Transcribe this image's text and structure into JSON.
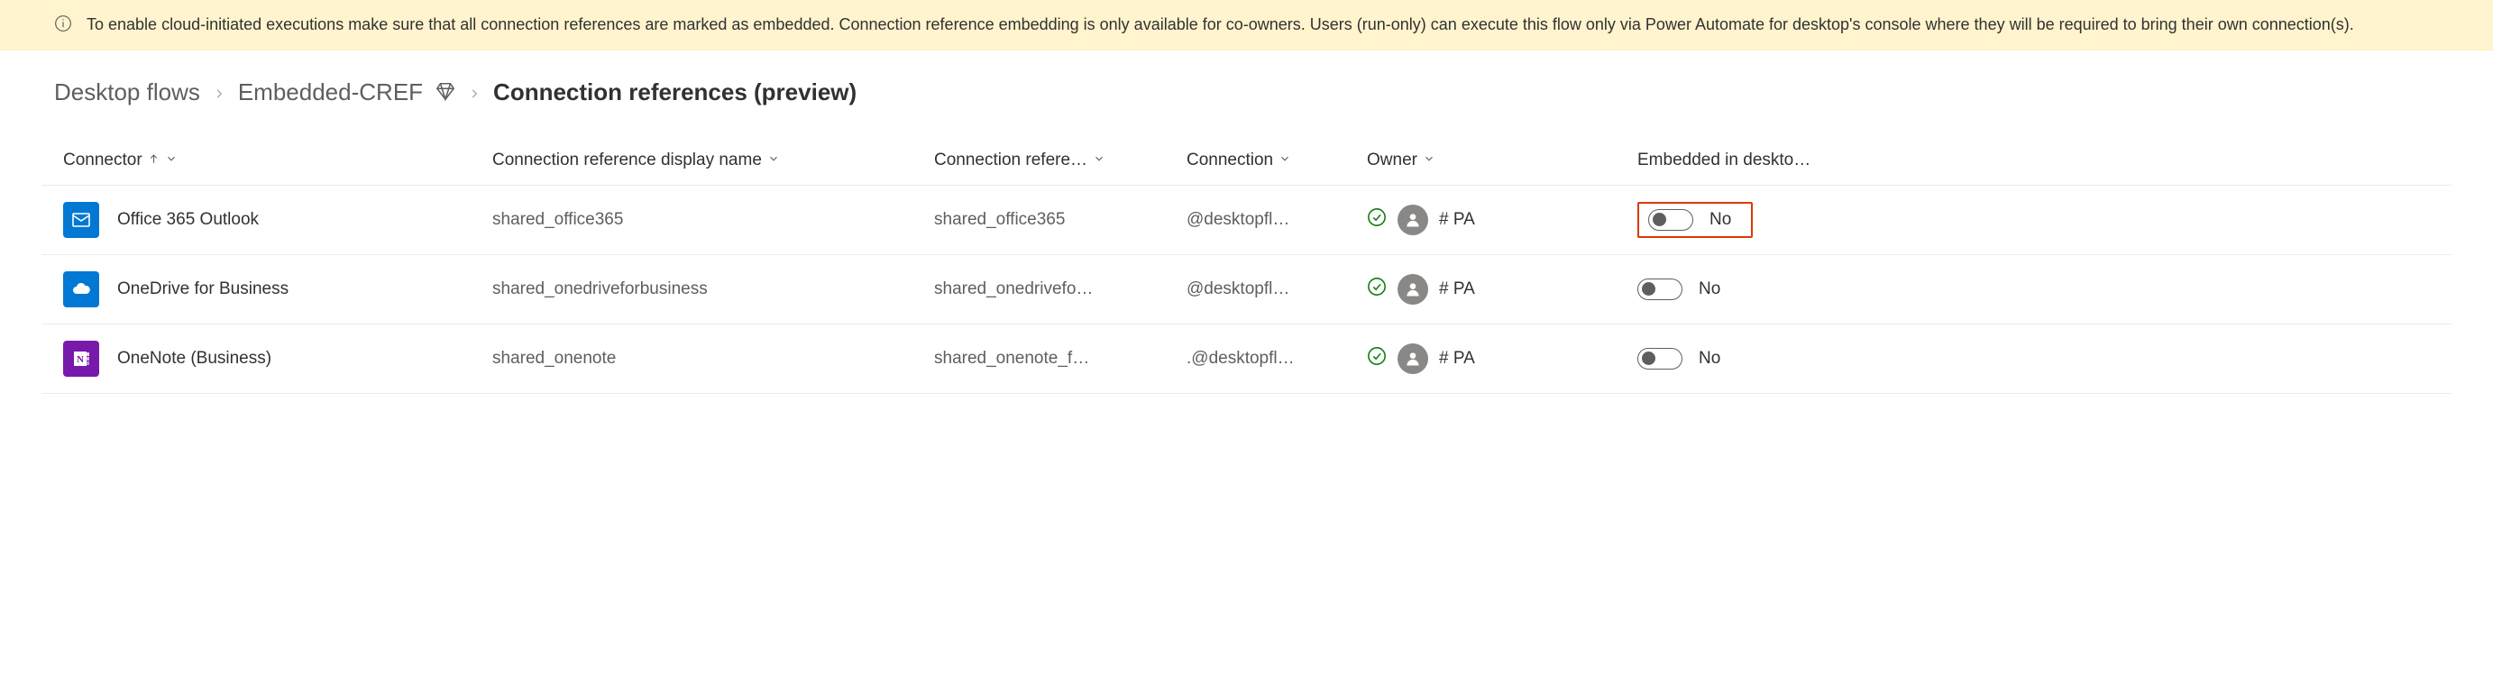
{
  "banner": {
    "text": "To enable cloud-initiated executions make sure that all connection references are marked as embedded. Connection reference embedding is only available for co-owners. Users (run-only) can execute this flow only via Power Automate for desktop's console where they will be required to bring their own connection(s)."
  },
  "breadcrumb": {
    "root": "Desktop flows",
    "flow": "Embedded-CREF",
    "current": "Connection references (preview)"
  },
  "columns": {
    "connector": "Connector",
    "display_name": "Connection reference display name",
    "ref_name": "Connection refere…",
    "connection": "Connection",
    "owner": "Owner",
    "embedded": "Embedded in deskto…"
  },
  "rows": [
    {
      "icon": "outlook",
      "connector": "Office 365 Outlook",
      "display_name": "shared_office365",
      "ref_name": "shared_office365",
      "connection": "@desktopfl…",
      "owner": "# PA",
      "embedded_label": "No",
      "highlight": true
    },
    {
      "icon": "onedrive",
      "connector": "OneDrive for Business",
      "display_name": "shared_onedriveforbusiness",
      "ref_name": "shared_onedrivefo…",
      "connection": "@desktopfl…",
      "owner": "# PA",
      "embedded_label": "No",
      "highlight": false
    },
    {
      "icon": "onenote",
      "connector": "OneNote (Business)",
      "display_name": "shared_onenote",
      "ref_name": "shared_onenote_f…",
      "connection": ".@desktopfl…",
      "owner": "# PA",
      "embedded_label": "No",
      "highlight": false
    }
  ]
}
